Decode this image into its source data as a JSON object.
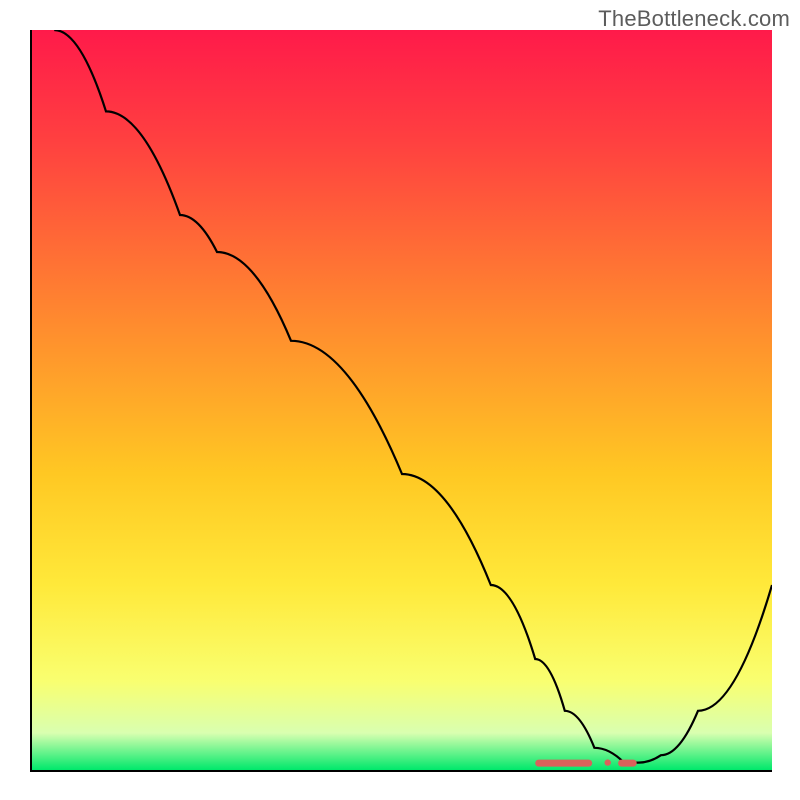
{
  "watermark": "TheBottleneck.com",
  "chart_data": {
    "type": "line",
    "title": "",
    "xlabel": "",
    "ylabel": "",
    "xlim": [
      0,
      100
    ],
    "ylim": [
      0,
      100
    ],
    "grid": false,
    "series": [
      {
        "name": "curve",
        "x": [
          3,
          10,
          20,
          25,
          35,
          50,
          62,
          68,
          72,
          76,
          80,
          82,
          85,
          90,
          100
        ],
        "y": [
          100,
          89,
          75,
          70,
          58,
          40,
          25,
          15,
          8,
          3,
          1,
          1,
          2,
          8,
          25
        ]
      }
    ],
    "markers": {
      "name": "band",
      "x_range": [
        68,
        82
      ],
      "y": 1
    },
    "gradient_stops": [
      {
        "offset": 0.0,
        "color": "#ff1a4a"
      },
      {
        "offset": 0.15,
        "color": "#ff4040"
      },
      {
        "offset": 0.4,
        "color": "#ff8c2e"
      },
      {
        "offset": 0.6,
        "color": "#ffc823"
      },
      {
        "offset": 0.75,
        "color": "#ffe93a"
      },
      {
        "offset": 0.88,
        "color": "#f9ff70"
      },
      {
        "offset": 0.95,
        "color": "#d9ffb0"
      },
      {
        "offset": 1.0,
        "color": "#00e86b"
      }
    ]
  }
}
